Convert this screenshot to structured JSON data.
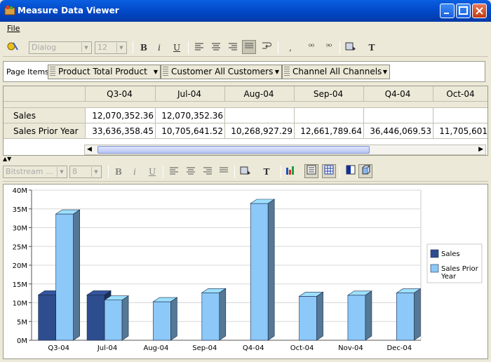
{
  "window": {
    "title": "Measure Data Viewer"
  },
  "menu": {
    "file": "File"
  },
  "toolbar1": {
    "font_family": "Dialog",
    "font_size": "12"
  },
  "toolbar2": {
    "font_family": "Bitstream ...",
    "font_size": "8"
  },
  "page_items": {
    "label": "Page Items",
    "dropdowns": [
      "Product  Total Product",
      "Customer  All Customers",
      "Channel  All Channels"
    ]
  },
  "grid": {
    "columns": [
      "Q3-04",
      "Jul-04",
      "Aug-04",
      "Sep-04",
      "Q4-04",
      "Oct-04"
    ],
    "rows": [
      {
        "label": "Sales",
        "values": [
          "12,070,352.36",
          "12,070,352.36",
          "",
          "",
          "",
          ""
        ]
      },
      {
        "label": "Sales Prior Year",
        "values": [
          "33,636,358.45",
          "10,705,641.52",
          "10,268,927.29",
          "12,661,789.64",
          "36,446,069.53",
          "11,705,601"
        ]
      }
    ]
  },
  "chart_data": {
    "type": "bar",
    "categories": [
      "Q3-04",
      "Jul-04",
      "Aug-04",
      "Sep-04",
      "Q4-04",
      "Oct-04",
      "Nov-04",
      "Dec-04"
    ],
    "series": [
      {
        "name": "Sales",
        "color": "#2e4d8f",
        "values": [
          12.07,
          12.07,
          null,
          null,
          null,
          null,
          null,
          null
        ]
      },
      {
        "name": "Sales Prior Year",
        "color": "#8cc8f8",
        "values": [
          33.64,
          10.71,
          10.27,
          12.66,
          36.45,
          11.71,
          12.0,
          12.6
        ]
      }
    ],
    "yticks": [
      "0M",
      "5M",
      "10M",
      "15M",
      "20M",
      "25M",
      "30M",
      "35M",
      "40M"
    ],
    "ylim": [
      0,
      40
    ],
    "legend": [
      {
        "label": "Sales",
        "color": "#2e4d8f"
      },
      {
        "label": "Sales Prior Year",
        "color": "#8cc8f8"
      }
    ],
    "legend_position": "right",
    "grid": true
  }
}
